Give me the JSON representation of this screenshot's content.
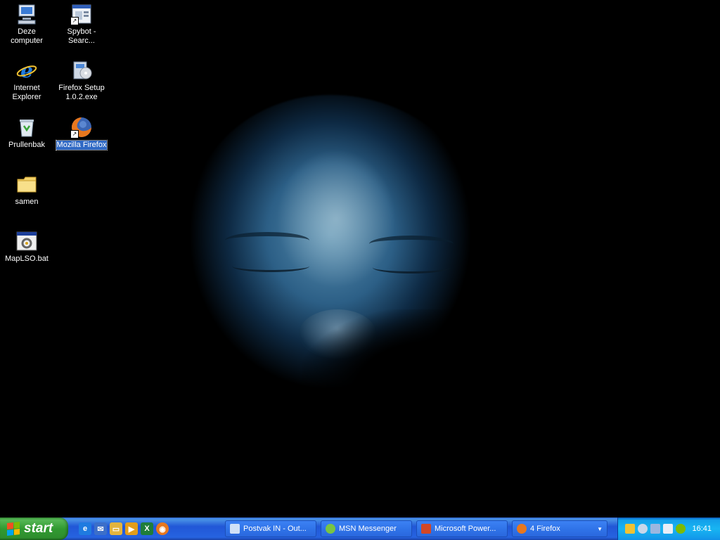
{
  "desktop": {
    "icons": [
      {
        "label": "Deze computer",
        "icon": "my-computer-icon"
      },
      {
        "label": "Spybot - Searc...",
        "icon": "spybot-icon"
      },
      {
        "label": "Internet Explorer",
        "icon": "internet-explorer-icon"
      },
      {
        "label": "Firefox Setup 1.0.2.exe",
        "icon": "installer-icon"
      },
      {
        "label": "Prullenbak",
        "icon": "recycle-bin-icon"
      },
      {
        "label": "Mozilla Firefox",
        "icon": "firefox-icon"
      },
      {
        "label": "samen",
        "icon": "folder-icon"
      },
      {
        "label": "MapLSO.bat",
        "icon": "batch-file-icon"
      }
    ]
  },
  "taskbar": {
    "start_label": "start",
    "quick_launch": [
      "internet-explorer-icon",
      "outlook-icon",
      "folder-icon",
      "media-player-icon",
      "excel-icon",
      "firefox-icon"
    ],
    "tasks": [
      {
        "label": "Postvak IN - Out...",
        "icon": "outlook-icon"
      },
      {
        "label": "MSN Messenger",
        "icon": "msn-messenger-icon"
      },
      {
        "label": "Microsoft Power...",
        "icon": "powerpoint-icon"
      },
      {
        "label": "4 Firefox",
        "icon": "firefox-icon"
      }
    ],
    "clock": "16:41"
  },
  "colors": {
    "taskbar_blue": "#2157d7",
    "start_green": "#319a31",
    "tray_blue": "#18b5f2",
    "selection_blue": "#316ac5"
  }
}
